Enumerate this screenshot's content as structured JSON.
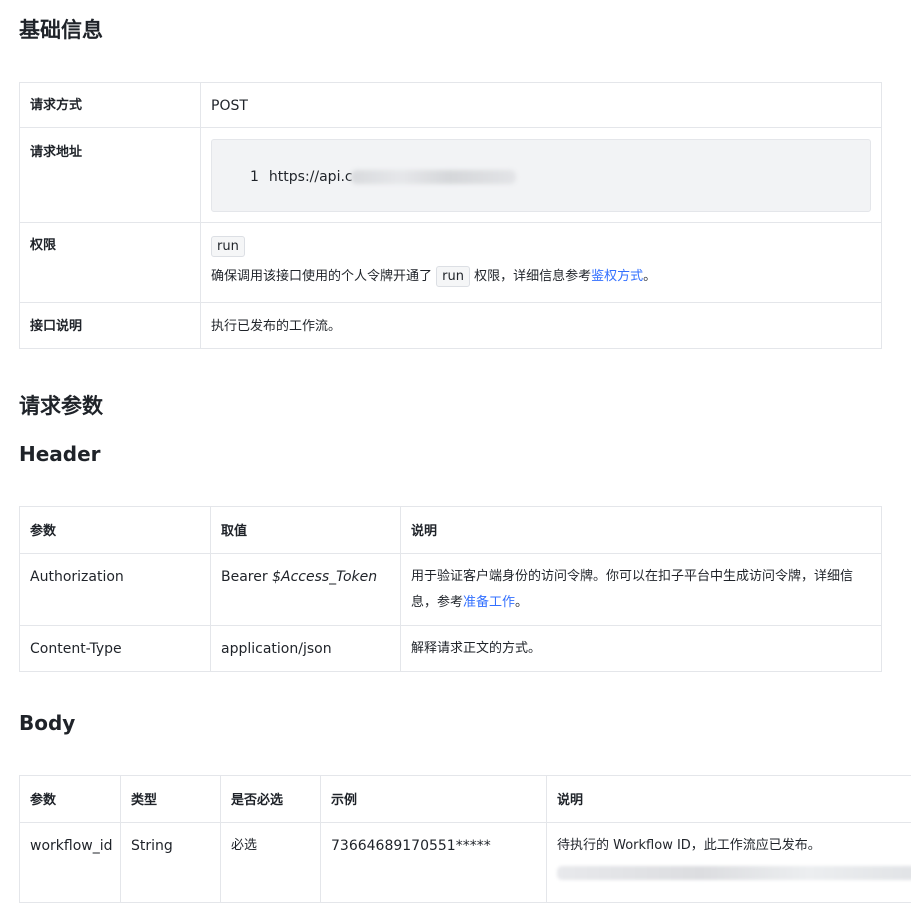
{
  "sections": {
    "basic_info_title": "基础信息",
    "request_params_title": "请求参数",
    "header_title": "Header",
    "body_title": "Body"
  },
  "basic_info": {
    "method_label": "请求方式",
    "method_value": "POST",
    "url_label": "请求地址",
    "url_line_number": "1",
    "url_visible": "https://api.c",
    "permission_label": "权限",
    "permission_tag": "run",
    "permission_text_before": "确保调用该接口使用的个人令牌开通了",
    "permission_text_tag": "run",
    "permission_text_after": "权限，详细信息参考",
    "permission_link": "鉴权方式",
    "permission_text_end": "。",
    "description_label": "接口说明",
    "description_value": "执行已发布的工作流。"
  },
  "header_table": {
    "columns": [
      "参数",
      "取值",
      "说明"
    ],
    "rows": [
      {
        "param": "Authorization",
        "value_prefix": "Bearer ",
        "value_var": "$Access_Token",
        "desc_before": "用于验证客户端身份的访问令牌。你可以在扣子平台中生成访问令牌，详细信息，参考",
        "desc_link": "准备工作",
        "desc_after": "。"
      },
      {
        "param": "Content-Type",
        "value": "application/json",
        "desc": "解释请求正文的方式。"
      }
    ]
  },
  "body_table": {
    "columns": [
      "参数",
      "类型",
      "是否必选",
      "示例",
      "说明"
    ],
    "rows": [
      {
        "param": "workflow_id",
        "type": "String",
        "required": "必选",
        "example": "73664689170551*****",
        "desc": "待执行的 Workflow ID，此工作流应已发布。"
      }
    ]
  }
}
